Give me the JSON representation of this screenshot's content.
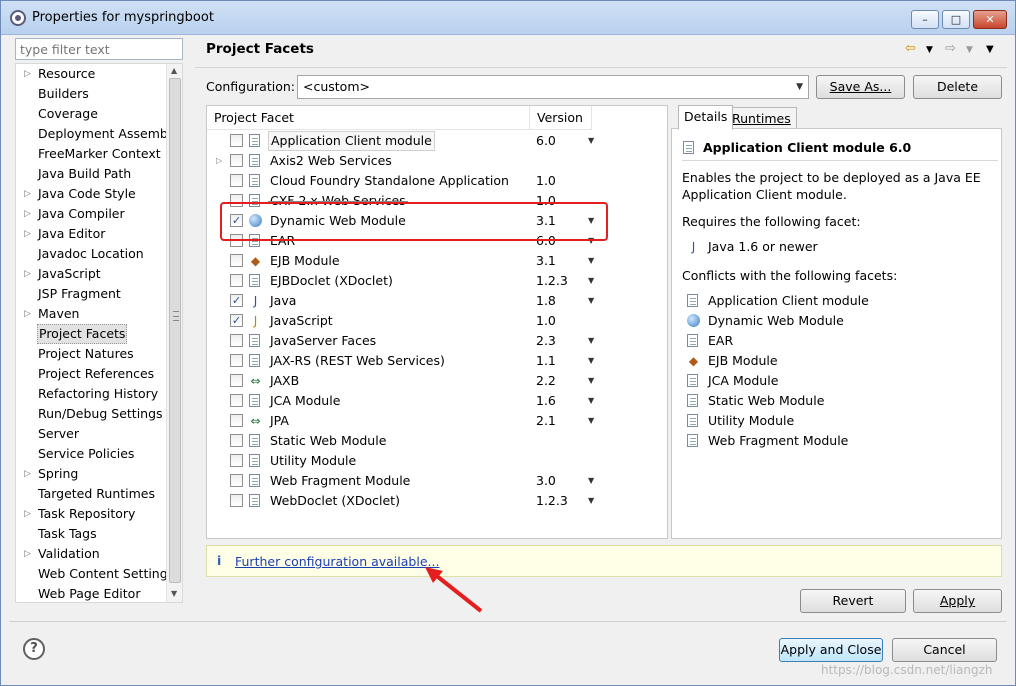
{
  "window": {
    "title": "Properties for myspringboot",
    "minimize": "–",
    "maximize": "□",
    "close": "✕"
  },
  "filter": {
    "placeholder": "type filter text"
  },
  "nav": {
    "items": [
      {
        "label": "Resource",
        "expandable": true
      },
      {
        "label": "Builders",
        "expandable": false
      },
      {
        "label": "Coverage",
        "expandable": false
      },
      {
        "label": "Deployment Assembly",
        "expandable": false
      },
      {
        "label": "FreeMarker Context",
        "expandable": false
      },
      {
        "label": "Java Build Path",
        "expandable": false
      },
      {
        "label": "Java Code Style",
        "expandable": true
      },
      {
        "label": "Java Compiler",
        "expandable": true
      },
      {
        "label": "Java Editor",
        "expandable": true
      },
      {
        "label": "Javadoc Location",
        "expandable": false
      },
      {
        "label": "JavaScript",
        "expandable": true
      },
      {
        "label": "JSP Fragment",
        "expandable": false
      },
      {
        "label": "Maven",
        "expandable": true
      },
      {
        "label": "Project Facets",
        "expandable": false,
        "selected": true
      },
      {
        "label": "Project Natures",
        "expandable": false
      },
      {
        "label": "Project References",
        "expandable": false
      },
      {
        "label": "Refactoring History",
        "expandable": false
      },
      {
        "label": "Run/Debug Settings",
        "expandable": false
      },
      {
        "label": "Server",
        "expandable": false
      },
      {
        "label": "Service Policies",
        "expandable": false
      },
      {
        "label": "Spring",
        "expandable": true
      },
      {
        "label": "Targeted Runtimes",
        "expandable": false
      },
      {
        "label": "Task Repository",
        "expandable": true
      },
      {
        "label": "Task Tags",
        "expandable": false
      },
      {
        "label": "Validation",
        "expandable": true
      },
      {
        "label": "Web Content Settings",
        "expandable": false
      },
      {
        "label": "Web Page Editor",
        "expandable": false
      }
    ]
  },
  "page": {
    "title": "Project Facets",
    "configuration_label": "Configuration:",
    "configuration_value": "<custom>",
    "save_as": "Save As...",
    "delete": "Delete"
  },
  "facets": {
    "col_facet": "Project Facet",
    "col_version": "Version",
    "rows": [
      {
        "name": "Application Client module",
        "version": "6.0",
        "checked": false,
        "icon": "doc",
        "dropdown": true,
        "boxed": true
      },
      {
        "name": "Axis2 Web Services",
        "version": "",
        "checked": false,
        "icon": "doc",
        "dropdown": false,
        "expandable": true
      },
      {
        "name": "Cloud Foundry Standalone Application",
        "version": "1.0",
        "checked": false,
        "icon": "doc",
        "dropdown": false
      },
      {
        "name": "CXF 2.x Web Services",
        "version": "1.0",
        "checked": false,
        "icon": "doc",
        "dropdown": false,
        "strike": true
      },
      {
        "name": "Dynamic Web Module",
        "version": "3.1",
        "checked": true,
        "icon": "globe",
        "dropdown": true
      },
      {
        "name": "EAR",
        "version": "6.0",
        "checked": false,
        "icon": "doc",
        "dropdown": true
      },
      {
        "name": "EJB Module",
        "version": "3.1",
        "checked": false,
        "icon": "bean",
        "dropdown": true
      },
      {
        "name": "EJBDoclet (XDoclet)",
        "version": "1.2.3",
        "checked": false,
        "icon": "doc",
        "dropdown": true
      },
      {
        "name": "Java",
        "version": "1.8",
        "checked": true,
        "icon": "jar",
        "dropdown": true
      },
      {
        "name": "JavaScript",
        "version": "1.0",
        "checked": true,
        "icon": "js",
        "dropdown": false
      },
      {
        "name": "JavaServer Faces",
        "version": "2.3",
        "checked": false,
        "icon": "doc",
        "dropdown": true
      },
      {
        "name": "JAX-RS (REST Web Services)",
        "version": "1.1",
        "checked": false,
        "icon": "doc",
        "dropdown": true
      },
      {
        "name": "JAXB",
        "version": "2.2",
        "checked": false,
        "icon": "arrows",
        "dropdown": true
      },
      {
        "name": "JCA Module",
        "version": "1.6",
        "checked": false,
        "icon": "doc",
        "dropdown": true
      },
      {
        "name": "JPA",
        "version": "2.1",
        "checked": false,
        "icon": "arrows",
        "dropdown": true
      },
      {
        "name": "Static Web Module",
        "version": "",
        "checked": false,
        "icon": "doc",
        "dropdown": false
      },
      {
        "name": "Utility Module",
        "version": "",
        "checked": false,
        "icon": "doc",
        "dropdown": false
      },
      {
        "name": "Web Fragment Module",
        "version": "3.0",
        "checked": false,
        "icon": "doc",
        "dropdown": true
      },
      {
        "name": "WebDoclet (XDoclet)",
        "version": "1.2.3",
        "checked": false,
        "icon": "doc",
        "dropdown": true
      }
    ]
  },
  "details": {
    "tab_details": "Details",
    "tab_runtimes": "Runtimes",
    "title": "Application Client module 6.0",
    "description": "Enables the project to be deployed as a Java EE Application Client module.",
    "requires_label": "Requires the following facet:",
    "requires": [
      {
        "name": "Java 1.6 or newer",
        "icon": "jar"
      }
    ],
    "conflicts_label": "Conflicts with the following facets:",
    "conflicts": [
      {
        "name": "Application Client module",
        "icon": "doc"
      },
      {
        "name": "Dynamic Web Module",
        "icon": "globe"
      },
      {
        "name": "EAR",
        "icon": "doc"
      },
      {
        "name": "EJB Module",
        "icon": "bean"
      },
      {
        "name": "JCA Module",
        "icon": "doc"
      },
      {
        "name": "Static Web Module",
        "icon": "doc"
      },
      {
        "name": "Utility Module",
        "icon": "doc"
      },
      {
        "name": "Web Fragment Module",
        "icon": "doc"
      }
    ]
  },
  "info": {
    "icon": "i",
    "link": "Further configuration available..."
  },
  "buttons": {
    "revert": "Revert",
    "apply": "Apply",
    "apply_close": "Apply and Close",
    "cancel": "Cancel"
  },
  "watermark": "https://blog.csdn.net/liangzh",
  "colors": {
    "highlight_box": "#e41e1e",
    "link": "#1a3fb0",
    "info_bg": "#ffffe8"
  }
}
